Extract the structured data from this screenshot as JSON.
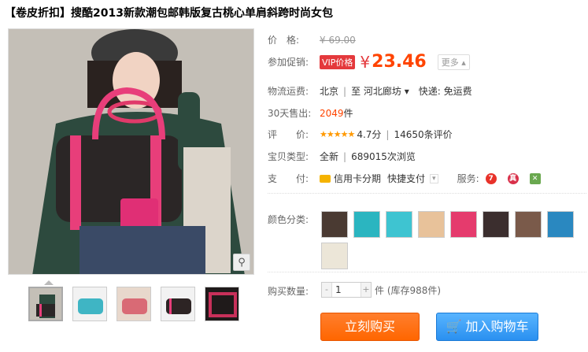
{
  "product": {
    "title_bracket": "【卷皮折扣】",
    "title": "搜酷2013新款潮包邮韩版复古桃心单肩斜跨时尚女包"
  },
  "gallery": {
    "zoom_icon": "magnifier-icon",
    "thumbnail_colors": [
      "#3a2a26",
      "#3fb5c4",
      "#d96a75",
      "#2d2424",
      "#c8305a"
    ]
  },
  "price": {
    "label": "价　格:",
    "original": "¥ 69.00"
  },
  "promo": {
    "label": "参加促销:",
    "vip_badge": "VIP价格",
    "currency": "¥",
    "price": "23.46",
    "more": "更多 ▴"
  },
  "shipping": {
    "label": "物流运费:",
    "from": "北京",
    "to_word": "至",
    "to": "河北廊坊 ▾",
    "method": "快递: 免运费"
  },
  "sales": {
    "label": "30天售出:",
    "count": "2049",
    "unit": "件"
  },
  "rating": {
    "label": "评　　价:",
    "stars": "★★★★★",
    "score": "4.7分",
    "reviews": "14650条评价"
  },
  "type": {
    "label": "宝贝类型:",
    "condition": "全新",
    "views": "689015次浏览"
  },
  "payment": {
    "label": "支　　付:",
    "installment": "信用卡分期",
    "quick": "快捷支付",
    "services_label": "服务:",
    "service_icons": [
      {
        "name": "seven-day-return-icon",
        "text": "7",
        "color": "#e8322a"
      },
      {
        "name": "authentic-guarantee-icon",
        "text": "真",
        "color": "#d9304a"
      },
      {
        "name": "consumer-protection-icon",
        "text": "✕",
        "color": "#6aa84f"
      }
    ]
  },
  "colors": {
    "label": "颜色分类:",
    "swatches": [
      "#4a3a32",
      "#2bb5c0",
      "#3ec4d1",
      "#e8c29a",
      "#e53b6d",
      "#3b2e2e",
      "#7a5a4a",
      "#2a88c0",
      "#ece6d8"
    ]
  },
  "quantity": {
    "label": "购买数量:",
    "minus": "-",
    "value": "1",
    "plus": "+",
    "stock": "件 (库存988件)"
  },
  "actions": {
    "buy_now": "立刻购买",
    "add_cart": "加入购物车",
    "cart_icon": "shopping-cart-icon"
  }
}
